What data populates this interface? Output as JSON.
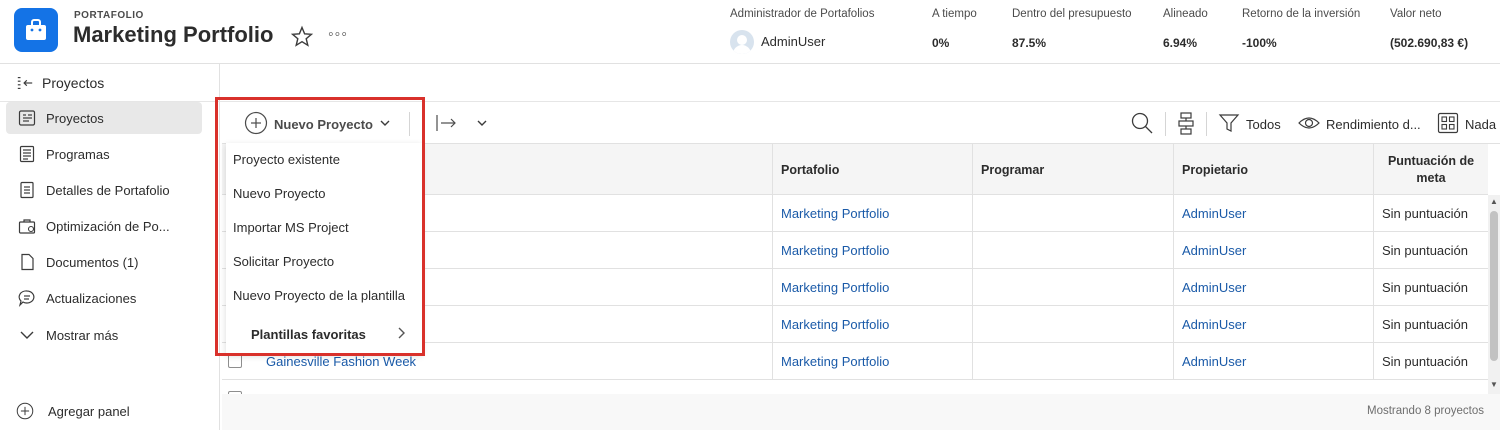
{
  "header": {
    "kicker": "PORTAFOLIO",
    "title": "Marketing Portfolio",
    "more": "◦◦◦",
    "metrics": [
      {
        "label": "Administrador de Portafolios",
        "value": "AdminUser"
      },
      {
        "label": "A tiempo",
        "value": "0%"
      },
      {
        "label": "Dentro del presupuesto",
        "value": "87.5%"
      },
      {
        "label": "Alineado",
        "value": "6.94%"
      },
      {
        "label": "Retorno de la inversión",
        "value": "-100%"
      },
      {
        "label": "Valor neto",
        "value": "(502.690,83 €)"
      }
    ]
  },
  "sidebar": {
    "heading": "Proyectos",
    "items": [
      {
        "label": "Proyectos",
        "icon": "projects-icon",
        "active": true
      },
      {
        "label": "Programas",
        "icon": "programs-icon"
      },
      {
        "label": "Detalles de Portafolio",
        "icon": "details-icon"
      },
      {
        "label": "Optimización de Po...",
        "icon": "optimization-icon"
      },
      {
        "label": "Documentos (1)",
        "icon": "document-icon"
      },
      {
        "label": "Actualizaciones",
        "icon": "updates-icon"
      },
      {
        "label": "Mostrar más",
        "icon": "chevron-down-icon"
      }
    ],
    "add_panel": "Agregar panel"
  },
  "toolbar": {
    "new_project": "Nuevo Proyecto",
    "filter": "Todos",
    "view": "Rendimiento d...",
    "grouping": "Nada"
  },
  "menu": {
    "items": [
      "Proyecto existente",
      "Nuevo Proyecto",
      "Importar MS Project",
      "Solicitar Proyecto",
      "Nuevo Proyecto de la plantilla"
    ],
    "favorites": "Plantillas favoritas"
  },
  "table": {
    "columns": [
      "Portafolio",
      "Programar",
      "Propietario",
      "Puntuación de meta"
    ],
    "rows": [
      {
        "name": "",
        "portfolio": "Marketing Portfolio",
        "program": "",
        "owner": "AdminUser",
        "score": "Sin puntuación"
      },
      {
        "name": "",
        "portfolio": "Marketing Portfolio",
        "program": "",
        "owner": "AdminUser",
        "score": "Sin puntuación"
      },
      {
        "name": "",
        "portfolio": "Marketing Portfolio",
        "program": "",
        "owner": "AdminUser",
        "score": "Sin puntuación"
      },
      {
        "name": "",
        "portfolio": "Marketing Portfolio",
        "program": "",
        "owner": "AdminUser",
        "score": "Sin puntuación"
      },
      {
        "name": "Gainesville Fashion Week",
        "portfolio": "Marketing Portfolio",
        "program": "",
        "owner": "AdminUser",
        "score": "Sin puntuación"
      }
    ]
  },
  "footer": {
    "count": "Mostrando 8 proyectos"
  },
  "colors": {
    "accent": "#1473e6",
    "link": "#1a5aa8",
    "highlight": "#d9312b"
  }
}
